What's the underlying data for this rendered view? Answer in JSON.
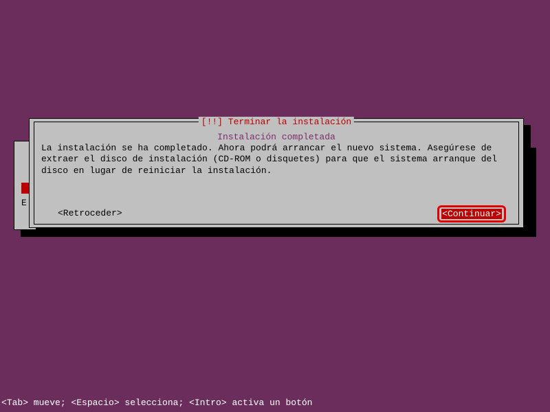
{
  "back_dialog": {
    "partial_char": "E"
  },
  "front_dialog": {
    "title": "[!!] Terminar la instalación",
    "subtitle": "Instalación completada",
    "body": "La instalación se ha completado. Ahora podrá arrancar el nuevo sistema. Asegúrese de extraer el disco de instalación (CD-ROM o disquetes) para que el sistema arranque del disco en lugar de reiniciar la instalación.",
    "back_button": "<Retroceder>",
    "continue_button": "<Continuar>"
  },
  "status_bar": "<Tab> mueve; <Espacio> selecciona; <Intro> activa un botón"
}
